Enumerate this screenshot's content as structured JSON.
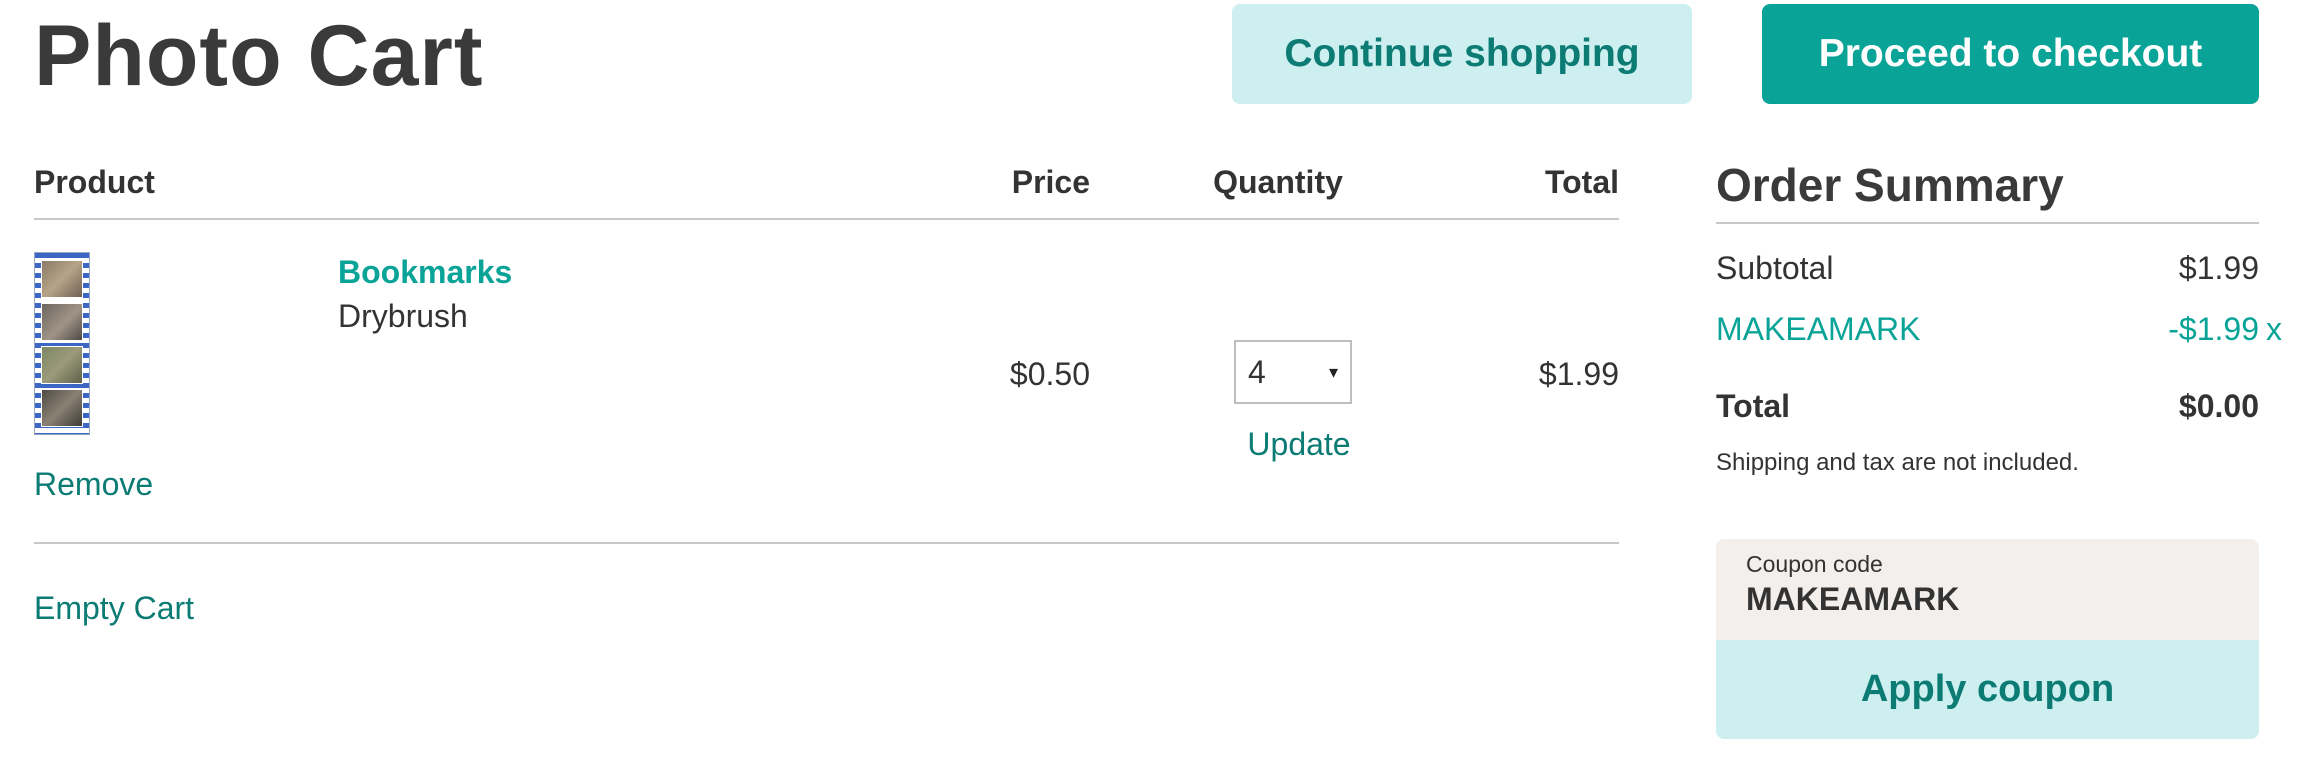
{
  "header": {
    "title": "Photo Cart",
    "continue_label": "Continue shopping",
    "checkout_label": "Proceed to checkout"
  },
  "table": {
    "columns": [
      "Product",
      "Price",
      "Quantity",
      "Total"
    ],
    "rows": [
      {
        "name": "Bookmarks",
        "variant": "Drybrush",
        "price": "$0.50",
        "quantity": "4",
        "total": "$1.99",
        "remove_label": "Remove",
        "update_label": "Update"
      }
    ],
    "empty_cart_label": "Empty Cart"
  },
  "summary": {
    "title": "Order Summary",
    "subtotal_label": "Subtotal",
    "subtotal_value": "$1.99",
    "discount_code": "MAKEAMARK",
    "discount_value": "-$1.99",
    "remove_discount": "x",
    "total_label": "Total",
    "total_value": "$0.00",
    "note": "Shipping and tax are not included."
  },
  "coupon": {
    "label": "Coupon code",
    "value": "MAKEAMARK",
    "apply_label": "Apply coupon"
  },
  "colors": {
    "accent": "#0aa397",
    "accent_dark": "#0b7b74",
    "accent_light": "#cdeff0",
    "coupon_bg": "#f2efec"
  },
  "icons": {
    "quantity_select": "chevron-down-icon"
  }
}
